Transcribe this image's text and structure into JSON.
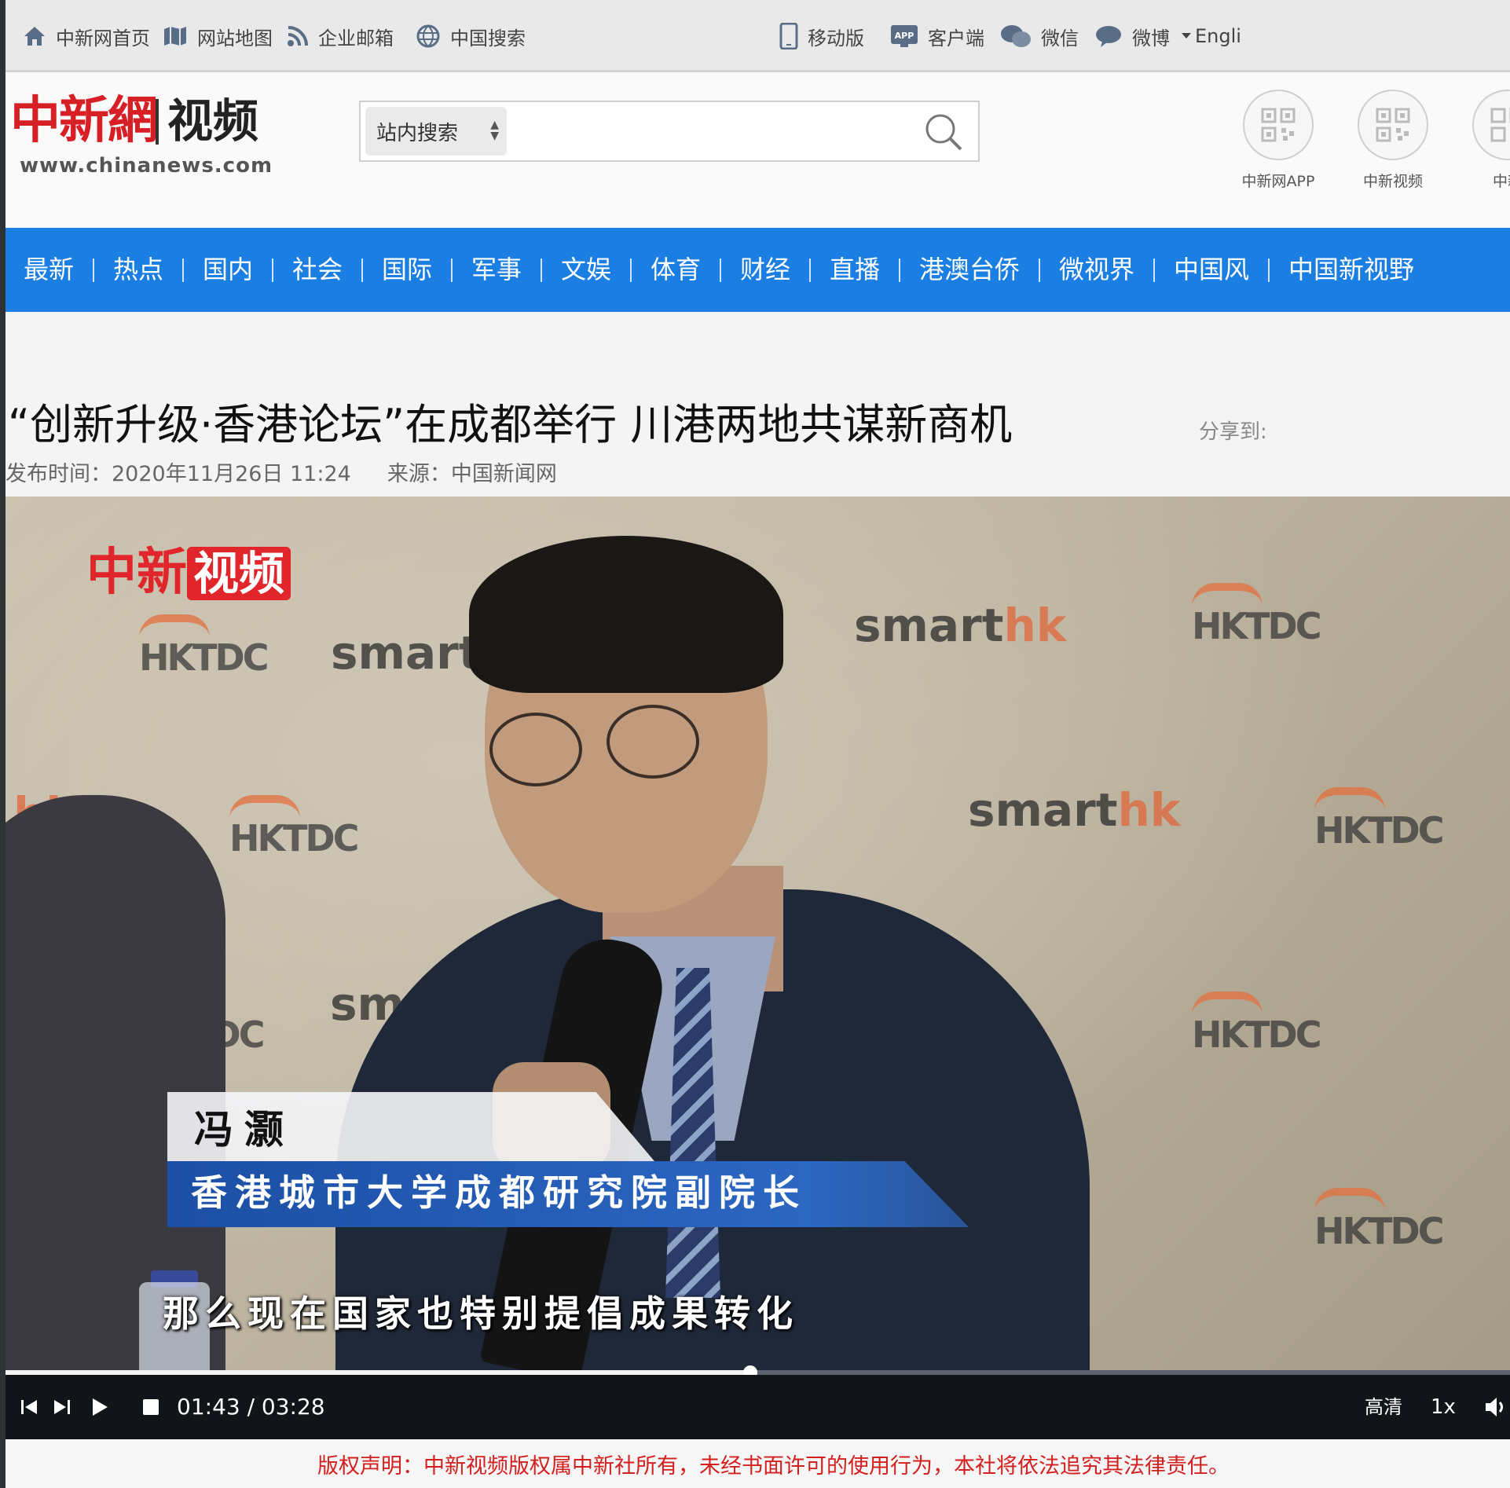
{
  "topbar": {
    "items": [
      {
        "label": "中新网首页",
        "icon": "home-icon"
      },
      {
        "label": "网站地图",
        "icon": "map-icon"
      },
      {
        "label": "企业邮箱",
        "icon": "rss-icon"
      },
      {
        "label": "中国搜索",
        "icon": "globe-search-icon"
      },
      {
        "label": "移动版",
        "icon": "mobile-icon"
      },
      {
        "label": "客户端",
        "icon": "app-icon"
      },
      {
        "label": "微信",
        "icon": "wechat-icon"
      },
      {
        "label": "微博",
        "icon": "weibo-icon"
      },
      {
        "label": "Engli"
      }
    ],
    "app_icon_text": "APP"
  },
  "header": {
    "logo": {
      "brand": "中新網",
      "channel": "视频",
      "url": "www.chinanews.com"
    },
    "search": {
      "scope": "站内搜索",
      "value": ""
    },
    "qr_codes": [
      {
        "label": "中新网APP"
      },
      {
        "label": "中新视频"
      },
      {
        "label": "中新"
      }
    ]
  },
  "nav": {
    "items": [
      "最新",
      "热点",
      "国内",
      "社会",
      "国际",
      "军事",
      "文娱",
      "体育",
      "财经",
      "直播",
      "港澳台侨",
      "微视界",
      "中国风",
      "中国新视野"
    ]
  },
  "article": {
    "title": "“创新升级·香港论坛”在成都举行 川港两地共谋新商机",
    "share_label": "分享到:",
    "published": "发布时间：2020年11月26日 11:24",
    "source": "来源：中国新闻网"
  },
  "video": {
    "logo_red": "中新",
    "logo_box": "视频",
    "backdrop_smart": "smart",
    "backdrop_hk": "hk",
    "backdrop_tdc": "HKTDC",
    "lower_third_name": "冯灏",
    "lower_third_title": "香港城市大学成都研究院副院长",
    "subtitle": "那么现在国家也特别提倡成果转化",
    "progress": 0.495,
    "time": "01:43 / 03:28",
    "quality": "高清",
    "speed": "1x"
  },
  "copyright": "版权声明：中新视频版权属中新社所有，未经书面许可的使用行为，本社将依法追究其法律责任。",
  "colors": {
    "nav_bg": "#1a7ee2",
    "brand_red": "#d71f26",
    "copyright_red": "#d3201f"
  }
}
